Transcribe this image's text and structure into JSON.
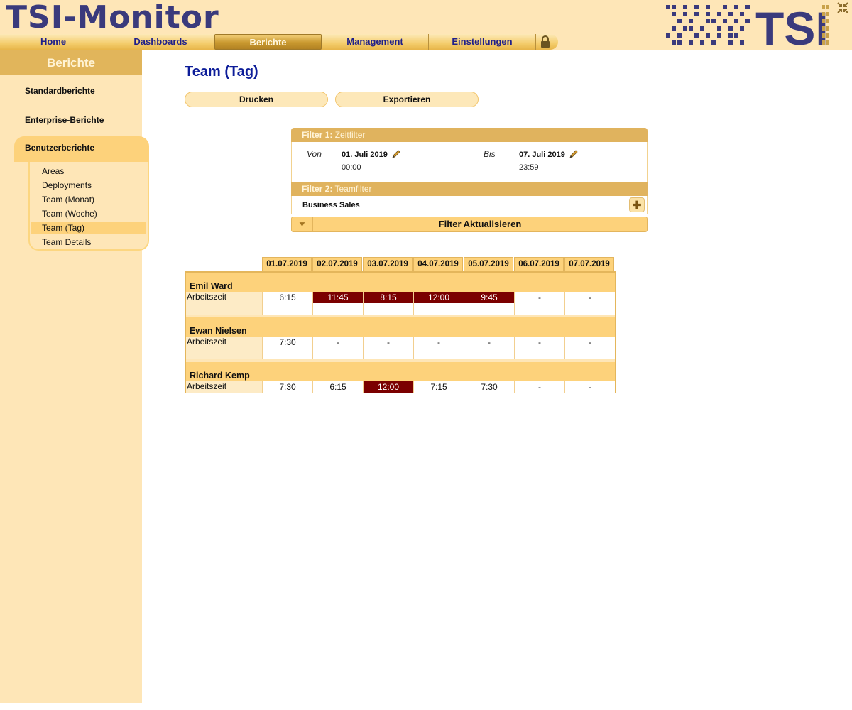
{
  "header": {
    "app_title": "TSI-Monitor",
    "logo_text": "TSI",
    "nav": [
      {
        "label": "Home",
        "active": false
      },
      {
        "label": "Dashboards",
        "active": false
      },
      {
        "label": "Berichte",
        "active": true
      },
      {
        "label": "Management",
        "active": false
      },
      {
        "label": "Einstellungen",
        "active": false
      }
    ]
  },
  "sidebar": {
    "title": "Berichte",
    "links": [
      "Standardberichte",
      "Enterprise-Berichte"
    ],
    "group": {
      "label": "Benutzerberichte",
      "items": [
        "Areas",
        "Deployments",
        "Team (Monat)",
        "Team (Woche)",
        "Team (Tag)",
        "Team Details"
      ],
      "selected": "Team (Tag)"
    }
  },
  "main": {
    "title": "Team (Tag)",
    "buttons": {
      "print": "Drucken",
      "export": "Exportieren"
    },
    "filter": {
      "f1_prefix": "Filter 1:",
      "f1_name": "Zeitfilter",
      "from_label": "Von",
      "from_date": "01. Juli 2019",
      "from_time": "00:00",
      "to_label": "Bis",
      "to_date": "07. Juli 2019",
      "to_time": "23:59",
      "f2_prefix": "Filter 2:",
      "f2_name": "Teamfilter",
      "team": "Business Sales",
      "update_label": "Filter Aktualisieren"
    },
    "table": {
      "dates": [
        "01.07.2019",
        "02.07.2019",
        "03.07.2019",
        "04.07.2019",
        "05.07.2019",
        "06.07.2019",
        "07.07.2019"
      ],
      "metric_label": "Arbeitszeit",
      "highlight_color": "#7b0000",
      "rows": [
        {
          "name": "Emil Ward",
          "values": [
            "6:15",
            "11:45",
            "8:15",
            "12:00",
            "9:45",
            "-",
            "-"
          ],
          "highlight": [
            false,
            true,
            true,
            true,
            true,
            false,
            false
          ]
        },
        {
          "name": "Ewan Nielsen",
          "values": [
            "7:30",
            "-",
            "-",
            "-",
            "-",
            "-",
            "-"
          ],
          "highlight": [
            false,
            false,
            false,
            false,
            false,
            false,
            false
          ]
        },
        {
          "name": "Richard Kemp",
          "values": [
            "7:30",
            "6:15",
            "12:00",
            "7:15",
            "7:30",
            "-",
            "-"
          ],
          "highlight": [
            false,
            false,
            true,
            false,
            false,
            false,
            false
          ]
        }
      ]
    }
  }
}
